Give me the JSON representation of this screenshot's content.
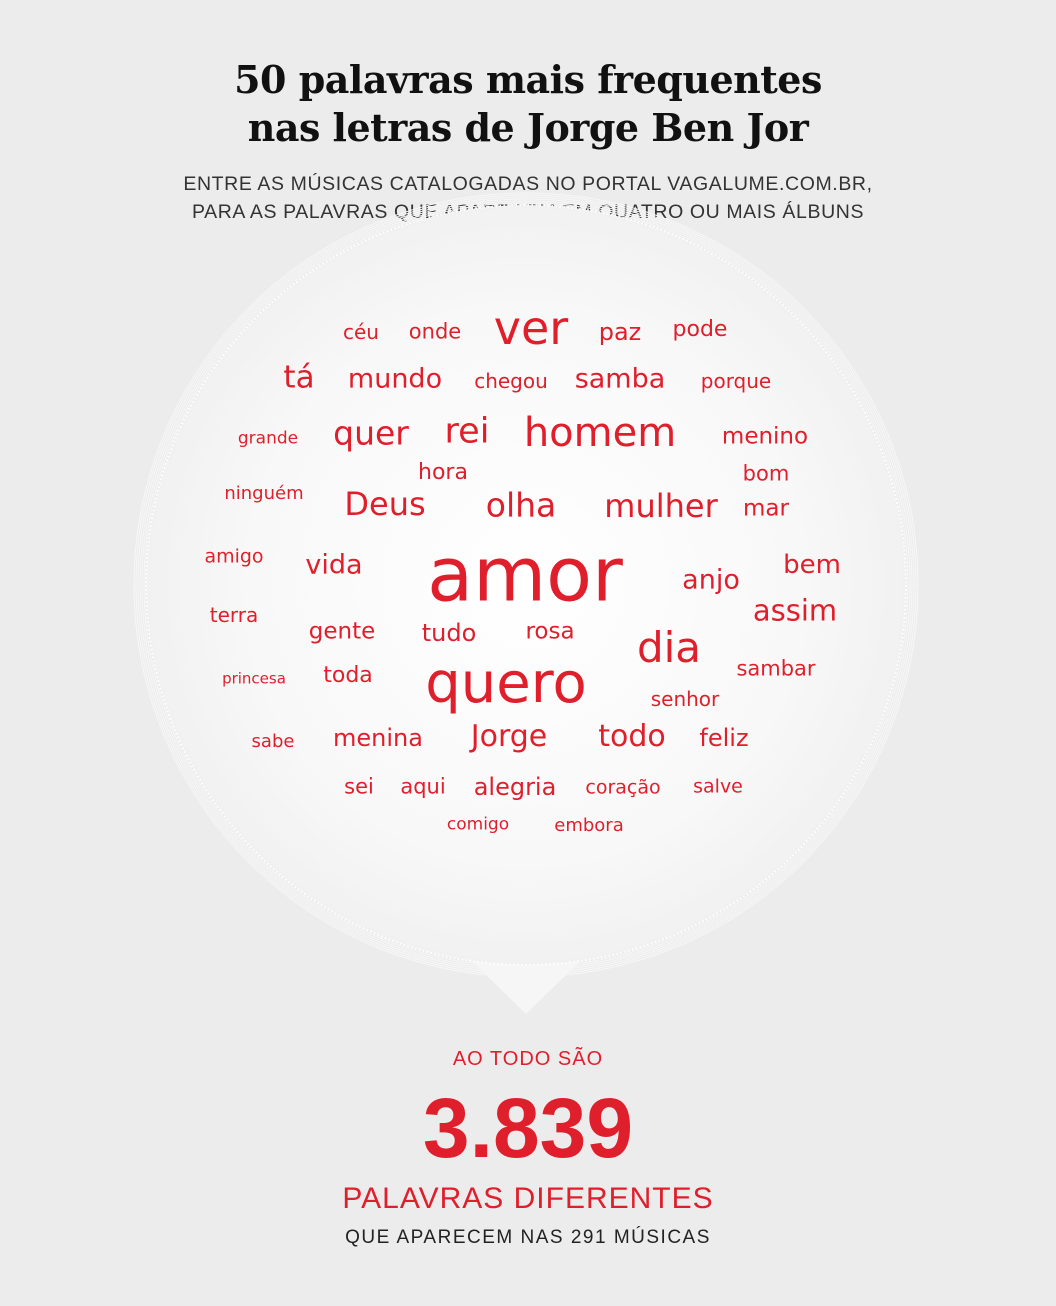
{
  "header": {
    "title_line1": "50 palavras mais frequentes",
    "title_line2": "nas letras de Jorge Ben Jor",
    "subtitle_line1": "ENTRE AS MÚSICAS CATALOGADAS NO PORTAL VAGALUME.COM.BR,",
    "subtitle_line2": "PARA AS PALAVRAS QUE APARECEM EM QUATRO OU MAIS ÁLBUNS"
  },
  "colors": {
    "accent": "#e01f2c",
    "background": "#ececec",
    "bubble": "#f7f7f7"
  },
  "word_cloud": [
    {
      "text": "céu",
      "weight": 1
    },
    {
      "text": "onde",
      "weight": 1
    },
    {
      "text": "ver",
      "weight": 4
    },
    {
      "text": "paz",
      "weight": 2
    },
    {
      "text": "pode",
      "weight": 2
    },
    {
      "text": "tá",
      "weight": 3
    },
    {
      "text": "mundo",
      "weight": 3
    },
    {
      "text": "chegou",
      "weight": 1
    },
    {
      "text": "samba",
      "weight": 3
    },
    {
      "text": "porque",
      "weight": 1
    },
    {
      "text": "grande",
      "weight": 1
    },
    {
      "text": "quer",
      "weight": 3
    },
    {
      "text": "rei",
      "weight": 3
    },
    {
      "text": "homem",
      "weight": 4
    },
    {
      "text": "menino",
      "weight": 2
    },
    {
      "text": "hora",
      "weight": 1
    },
    {
      "text": "bom",
      "weight": 1
    },
    {
      "text": "ninguém",
      "weight": 1
    },
    {
      "text": "Deus",
      "weight": 3
    },
    {
      "text": "olha",
      "weight": 3
    },
    {
      "text": "mulher",
      "weight": 3
    },
    {
      "text": "mar",
      "weight": 2
    },
    {
      "text": "amigo",
      "weight": 1
    },
    {
      "text": "vida",
      "weight": 2
    },
    {
      "text": "amor",
      "weight": 5
    },
    {
      "text": "anjo",
      "weight": 2
    },
    {
      "text": "bem",
      "weight": 2
    },
    {
      "text": "terra",
      "weight": 1
    },
    {
      "text": "assim",
      "weight": 3
    },
    {
      "text": "gente",
      "weight": 2
    },
    {
      "text": "tudo",
      "weight": 2
    },
    {
      "text": "rosa",
      "weight": 2
    },
    {
      "text": "dia",
      "weight": 4
    },
    {
      "text": "sambar",
      "weight": 1
    },
    {
      "text": "princesa",
      "weight": 1
    },
    {
      "text": "toda",
      "weight": 2
    },
    {
      "text": "quero",
      "weight": 5
    },
    {
      "text": "senhor",
      "weight": 1
    },
    {
      "text": "sabe",
      "weight": 1
    },
    {
      "text": "menina",
      "weight": 2
    },
    {
      "text": "Jorge",
      "weight": 3
    },
    {
      "text": "todo",
      "weight": 3
    },
    {
      "text": "feliz",
      "weight": 2
    },
    {
      "text": "sei",
      "weight": 2
    },
    {
      "text": "aqui",
      "weight": 2
    },
    {
      "text": "alegria",
      "weight": 2
    },
    {
      "text": "coração",
      "weight": 1
    },
    {
      "text": "salve",
      "weight": 1
    },
    {
      "text": "comigo",
      "weight": 1
    },
    {
      "text": "embora",
      "weight": 1
    }
  ],
  "stats": {
    "lead": "AO TODO SÃO",
    "total": "3.839",
    "unit": "PALAVRAS DIFERENTES",
    "note": "QUE APARECEM NAS 291 MÚSICAS"
  }
}
